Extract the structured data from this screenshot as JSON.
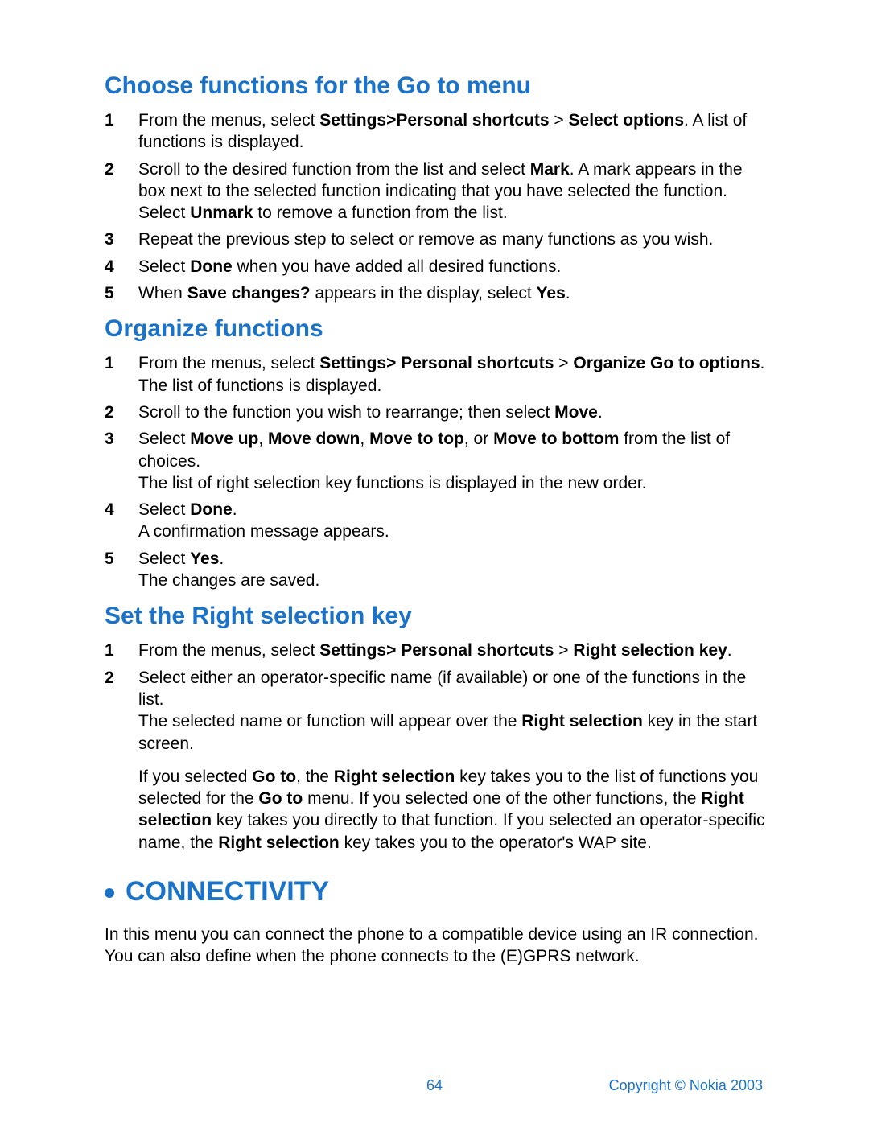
{
  "headings": {
    "choose": "Choose functions for the Go to menu",
    "organize": "Organize functions",
    "rightkey": "Set the Right selection key",
    "connectivity": "CONNECTIVITY"
  },
  "choose_steps": {
    "s1a": "From the menus, select ",
    "s1b": "Settings>Personal shortcuts",
    "s1c": " > ",
    "s1d": "Select options",
    "s1e": ". A list of functions is displayed.",
    "s2a": "Scroll to the desired function from the list and select ",
    "s2b": "Mark",
    "s2c": ". A mark appears in the box next to the selected function indicating that you have selected the function. Select ",
    "s2d": "Unmark",
    "s2e": " to remove a function from the list.",
    "s3": "Repeat the previous step to select or remove as many functions as you wish.",
    "s4a": "Select ",
    "s4b": "Done",
    "s4c": " when you have added all desired functions.",
    "s5a": "When ",
    "s5b": "Save changes?",
    "s5c": " appears in the display, select ",
    "s5d": "Yes",
    "s5e": "."
  },
  "organize_steps": {
    "s1a": "From the menus, select ",
    "s1b": "Settings> Personal shortcuts",
    "s1c": " > ",
    "s1d": "Organize Go to options",
    "s1e": ". The list of functions is displayed.",
    "s2a": "Scroll to the function you wish to rearrange; then select ",
    "s2b": "Move",
    "s2c": ".",
    "s3a": "Select ",
    "s3b": "Move up",
    "s3c": ", ",
    "s3d": "Move down",
    "s3e": ", ",
    "s3f": "Move to top",
    "s3g": ", or ",
    "s3h": "Move to bottom",
    "s3i": " from the list of choices.",
    "s3j": "The list of right selection key functions is displayed in the new order.",
    "s4a": "Select ",
    "s4b": "Done",
    "s4c": ".",
    "s4d": "A confirmation message appears.",
    "s5a": "Select ",
    "s5b": "Yes",
    "s5c": ".",
    "s5d": "The changes are saved."
  },
  "rightkey_steps": {
    "s1a": "From the menus, select ",
    "s1b": "Settings> Personal shortcuts",
    "s1c": " > ",
    "s1d": "Right selection key",
    "s1e": ".",
    "s2a": "Select either an operator-specific name (if available) or one of the functions in the list.",
    "s2b": "The selected name or function will appear over the ",
    "s2c": "Right selection",
    "s2d": " key in the start screen.",
    "p1a": "If you selected ",
    "p1b": "Go to",
    "p1c": ", the ",
    "p1d": "Right selection",
    "p1e": " key takes you to the list of functions you selected for the ",
    "p1f": "Go to",
    "p1g": " menu. If you selected one of the other functions, the ",
    "p1h": "Right selection",
    "p1i": " key takes you directly to that function. If you selected an operator-specific name, the ",
    "p1j": "Right selection",
    "p1k": " key takes you to the operator's WAP site."
  },
  "connectivity_intro": "In this menu you can connect the phone to a compatible device using an IR connection. You can also define when the phone connects to the (E)GPRS network.",
  "footer": {
    "page": "64",
    "copyright": "Copyright © Nokia 2003"
  }
}
